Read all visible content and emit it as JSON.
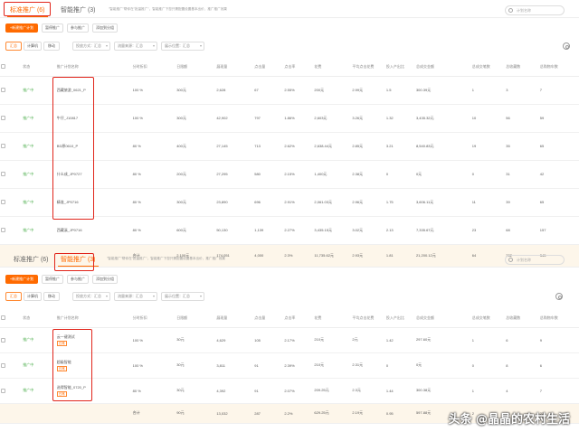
{
  "panel1": {
    "tabs": [
      {
        "label": "标准推广 (6)",
        "active": true
      },
      {
        "label": "智能推广 (3)",
        "active": false
      }
    ],
    "hint": "\"智能推广\"帮你在\"批量推广\"，智能推广下您只需配置设置基本出价，推广推广效果",
    "search_placeholder": "计划名称",
    "toolbar": {
      "new": "+新建推广计划",
      "pause": "暂停推广",
      "join": "参与推广",
      "add": "添加到分组"
    },
    "filters": [
      "汇总",
      "计算机",
      "移动"
    ],
    "dropdowns": [
      "投放方式：汇总",
      "流量来源：汇总",
      "展示位置：汇总"
    ],
    "headers": [
      "状态",
      "推广计划名称",
      "分时折扣",
      "日限额",
      "展现量",
      "点击量",
      "点击率",
      "花费",
      "平均点击花费",
      "投入产出比",
      "总成交金额",
      "总成交笔数",
      "总收藏数",
      "总购物车数"
    ],
    "rows": [
      {
        "status": "推广中",
        "name": "西藏旅游_0621_P",
        "discount": "100 %",
        "limit": "300元",
        "show": "2,628",
        "click": "67",
        "ctr": "2.55%",
        "cost": "200元",
        "cpc": "2.99元",
        "roi": "1.5",
        "gmv": "300.39元",
        "orders": "1",
        "fav": "3",
        "cart": "7"
      },
      {
        "status": "推广中",
        "name": "牛仔_J10817",
        "discount": "100 %",
        "limit": "300元",
        "show": "42,902",
        "click": "797",
        "ctr": "1.86%",
        "cost": "2,603元",
        "cpc": "3.26元",
        "roi": "1.32",
        "gmv": "3,435.32元",
        "orders": "10",
        "fav": "56",
        "cart": "59"
      },
      {
        "status": "推广中",
        "name": "BD原0610_P",
        "discount": "80 %",
        "limit": "400元",
        "show": "27,145",
        "click": "713",
        "ctr": "2.62%",
        "cost": "2,638.44元",
        "cpc": "2.85元",
        "roi": "3.21",
        "gmv": "8,540.83元",
        "orders": "19",
        "fav": "35",
        "cart": "65"
      },
      {
        "status": "推广中",
        "name": "什么成_JP0727",
        "discount": "80 %",
        "limit": "200元",
        "show": "27,295",
        "click": "580",
        "ctr": "2.15%",
        "cost": "1,400元",
        "cpc": "2.38元",
        "roi": "0",
        "gmv": "0元",
        "orders": "0",
        "fav": "31",
        "cart": "42"
      },
      {
        "status": "推广中",
        "name": "精准_JP0716",
        "discount": "80 %",
        "limit": "300元",
        "show": "23,890",
        "click": "696",
        "ctr": "2.91%",
        "cost": "2,061.03元",
        "cpc": "2.96元",
        "roi": "1.75",
        "gmv": "3,606.11元",
        "orders": "11",
        "fav": "39",
        "cart": "65"
      },
      {
        "status": "推广中",
        "name": "西藏溪_JP0716",
        "discount": "80 %",
        "limit": "600元",
        "show": "50,130",
        "click": "1,139",
        "ctr": "2.27%",
        "cost": "3,435.15元",
        "cpc": "3.02元",
        "roi": "2.13",
        "gmv": "7,335.67元",
        "orders": "23",
        "fav": "68",
        "cart": "157"
      }
    ],
    "total": {
      "label": "合计",
      "limit": "2,100元",
      "show": "174,051",
      "click": "4,000",
      "ctr": "2.3%",
      "cost": "11,735.62元",
      "cpc": "2.93元",
      "roi": "1.81",
      "gmv": "21,200.12元",
      "orders": "64",
      "fav": "232",
      "cart": "345"
    }
  },
  "panel2": {
    "tabs": [
      {
        "label": "标准推广 (6)",
        "active": false
      },
      {
        "label": "智能推广 (3)",
        "active": true
      }
    ],
    "hint": "\"智能推广\"帮你在\"批量推广\"，智能推广下您只需配置设置基本出价，推广推广效果",
    "search_placeholder": "计划名称",
    "toolbar": {
      "new": "+新建推广计划",
      "pause": "暂停推广",
      "join": "参与推广",
      "add": "添加到分组"
    },
    "filters": [
      "汇总",
      "计算机",
      "移动"
    ],
    "dropdowns": [
      "投放方式：汇总",
      "流量来源：汇总",
      "展示位置：汇总"
    ],
    "headers": [
      "状态",
      "推广计划名称",
      "分时折扣",
      "日限额",
      "展现量",
      "点击量",
      "点击率",
      "花费",
      "平均点击花费",
      "投入产出比",
      "总成交金额",
      "总成交笔数",
      "总收藏数",
      "总购物车数"
    ],
    "rows": [
      {
        "status": "推广中",
        "name": "云一键测试",
        "tag": "日常",
        "discount": "100 %",
        "limit": "30元",
        "show": "4,629",
        "click": "105",
        "ctr": "2.17%",
        "cost": "210元",
        "cpc": "2元",
        "roi": "1.42",
        "gmv": "297.60元",
        "orders": "1",
        "fav": "6",
        "cart": "9"
      },
      {
        "status": "推广中",
        "name": "超级智能",
        "tag": "日常",
        "discount": "100 %",
        "limit": "30元",
        "show": "3,811",
        "click": "91",
        "ctr": "2.39%",
        "cost": "210元",
        "cpc": "2.31元",
        "roi": "0",
        "gmv": "0元",
        "orders": "0",
        "fav": "8",
        "cart": "6"
      },
      {
        "status": "推广中",
        "name": "选得智能_0720_P",
        "tag": "日常",
        "discount": "80 %",
        "limit": "30元",
        "show": "4,392",
        "click": "91",
        "ctr": "2.07%",
        "cost": "209.25元",
        "cpc": "2.3元",
        "roi": "1.44",
        "gmv": "300.38元",
        "orders": "1",
        "fav": "4",
        "cart": "7"
      }
    ],
    "total": {
      "label": "合计",
      "limit": "90元",
      "show": "13,032",
      "click": "287",
      "ctr": "2.2%",
      "cost": "629.25元",
      "cpc": "2.19元",
      "roi": "0.95",
      "gmv": "597.88元",
      "orders": "2",
      "fav": "18",
      "cart": "22"
    }
  },
  "watermark": "头条 @晶晶的农村生活"
}
